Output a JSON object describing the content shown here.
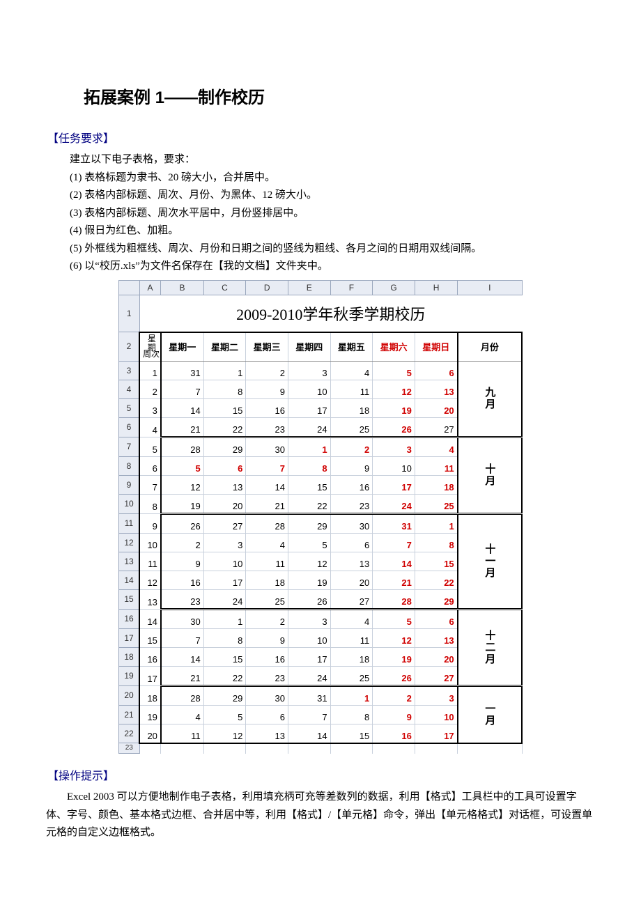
{
  "heading": "拓展案例 1——制作校历",
  "req_header": "【任务要求】",
  "req_intro": "建立以下电子表格，要求：",
  "reqs": [
    "(1) 表格标题为隶书、20 磅大小，合并居中。",
    "(2) 表格内部标题、周次、月份、为黑体、12 磅大小。",
    "(3) 表格内部标题、周次水平居中，月份竖排居中。",
    "(4) 假日为红色、加粗。",
    "(5) 外框线为粗框线、周次、月份和日期之间的竖线为粗线、各月之间的日期用双线间隔。",
    "(6) 以“校历.xls”为文件名保存在【我的文档】文件夹中。"
  ],
  "hint_header": "【操作提示】",
  "hint_text": "Excel 2003 可以方便地制作电子表格，利用填充柄可充等差数列的数据，利用【格式】工具栏中的工具可设置字体、字号、颜色、基本格式边框、合并居中等，利用【格式】/【单元格】命令，弹出【单元格格式】对话框，可设置单元格的自定义边框格式。",
  "chart_data": {
    "type": "table",
    "title": "2009-2010学年秋季学期校历",
    "col_letters": [
      "A",
      "B",
      "C",
      "D",
      "E",
      "F",
      "G",
      "H",
      "I"
    ],
    "corner": {
      "top_right": "星期",
      "bottom_left": "周次"
    },
    "headers": [
      "星期一",
      "星期二",
      "星期三",
      "星期四",
      "星期五",
      "星期六",
      "星期日",
      "月份"
    ],
    "month_groups": [
      {
        "label": "九月",
        "rows": [
          3,
          4,
          5,
          6
        ]
      },
      {
        "label": "十月",
        "rows": [
          7,
          8,
          9,
          10
        ]
      },
      {
        "label": "十一月",
        "rows": [
          11,
          12,
          13,
          14,
          15
        ]
      },
      {
        "label": "十二月",
        "rows": [
          16,
          17,
          18,
          19
        ]
      },
      {
        "label": "一月",
        "rows": [
          20,
          21,
          22
        ]
      }
    ],
    "rows": [
      {
        "r": 3,
        "week": 1,
        "d": [
          {
            "v": 31
          },
          {
            "v": 1
          },
          {
            "v": 2
          },
          {
            "v": 3
          },
          {
            "v": 4
          },
          {
            "v": 5,
            "h": true
          },
          {
            "v": 6,
            "h": true
          }
        ]
      },
      {
        "r": 4,
        "week": 2,
        "d": [
          {
            "v": 7
          },
          {
            "v": 8
          },
          {
            "v": 9
          },
          {
            "v": 10
          },
          {
            "v": 11
          },
          {
            "v": 12,
            "h": true
          },
          {
            "v": 13,
            "h": true
          }
        ]
      },
      {
        "r": 5,
        "week": 3,
        "d": [
          {
            "v": 14
          },
          {
            "v": 15
          },
          {
            "v": 16
          },
          {
            "v": 17
          },
          {
            "v": 18
          },
          {
            "v": 19,
            "h": true
          },
          {
            "v": 20,
            "h": true
          }
        ]
      },
      {
        "r": 6,
        "week": 4,
        "d": [
          {
            "v": 21
          },
          {
            "v": 22
          },
          {
            "v": 23
          },
          {
            "v": 24
          },
          {
            "v": 25
          },
          {
            "v": 26,
            "h": true
          },
          {
            "v": 27
          }
        ]
      },
      {
        "r": 7,
        "week": 5,
        "d": [
          {
            "v": 28
          },
          {
            "v": 29
          },
          {
            "v": 30
          },
          {
            "v": 1,
            "h": true
          },
          {
            "v": 2,
            "h": true
          },
          {
            "v": 3,
            "h": true
          },
          {
            "v": 4,
            "h": true
          }
        ]
      },
      {
        "r": 8,
        "week": 6,
        "d": [
          {
            "v": 5,
            "h": true
          },
          {
            "v": 6,
            "h": true
          },
          {
            "v": 7,
            "h": true
          },
          {
            "v": 8,
            "h": true
          },
          {
            "v": 9
          },
          {
            "v": 10
          },
          {
            "v": 11,
            "h": true
          }
        ]
      },
      {
        "r": 9,
        "week": 7,
        "d": [
          {
            "v": 12
          },
          {
            "v": 13
          },
          {
            "v": 14
          },
          {
            "v": 15
          },
          {
            "v": 16
          },
          {
            "v": 17,
            "h": true
          },
          {
            "v": 18,
            "h": true
          }
        ]
      },
      {
        "r": 10,
        "week": 8,
        "d": [
          {
            "v": 19
          },
          {
            "v": 20
          },
          {
            "v": 21
          },
          {
            "v": 22
          },
          {
            "v": 23
          },
          {
            "v": 24,
            "h": true
          },
          {
            "v": 25,
            "h": true
          }
        ]
      },
      {
        "r": 11,
        "week": 9,
        "d": [
          {
            "v": 26
          },
          {
            "v": 27
          },
          {
            "v": 28
          },
          {
            "v": 29
          },
          {
            "v": 30
          },
          {
            "v": 31,
            "h": true
          },
          {
            "v": 1,
            "h": true
          }
        ]
      },
      {
        "r": 12,
        "week": 10,
        "d": [
          {
            "v": 2
          },
          {
            "v": 3
          },
          {
            "v": 4
          },
          {
            "v": 5
          },
          {
            "v": 6
          },
          {
            "v": 7,
            "h": true
          },
          {
            "v": 8,
            "h": true
          }
        ]
      },
      {
        "r": 13,
        "week": 11,
        "d": [
          {
            "v": 9
          },
          {
            "v": 10
          },
          {
            "v": 11
          },
          {
            "v": 12
          },
          {
            "v": 13
          },
          {
            "v": 14,
            "h": true
          },
          {
            "v": 15,
            "h": true
          }
        ]
      },
      {
        "r": 14,
        "week": 12,
        "d": [
          {
            "v": 16
          },
          {
            "v": 17
          },
          {
            "v": 18
          },
          {
            "v": 19
          },
          {
            "v": 20
          },
          {
            "v": 21,
            "h": true
          },
          {
            "v": 22,
            "h": true
          }
        ]
      },
      {
        "r": 15,
        "week": 13,
        "d": [
          {
            "v": 23
          },
          {
            "v": 24
          },
          {
            "v": 25
          },
          {
            "v": 26
          },
          {
            "v": 27
          },
          {
            "v": 28,
            "h": true
          },
          {
            "v": 29,
            "h": true
          }
        ]
      },
      {
        "r": 16,
        "week": 14,
        "d": [
          {
            "v": 30
          },
          {
            "v": 1
          },
          {
            "v": 2
          },
          {
            "v": 3
          },
          {
            "v": 4
          },
          {
            "v": 5,
            "h": true
          },
          {
            "v": 6,
            "h": true
          }
        ]
      },
      {
        "r": 17,
        "week": 15,
        "d": [
          {
            "v": 7
          },
          {
            "v": 8
          },
          {
            "v": 9
          },
          {
            "v": 10
          },
          {
            "v": 11
          },
          {
            "v": 12,
            "h": true
          },
          {
            "v": 13,
            "h": true
          }
        ]
      },
      {
        "r": 18,
        "week": 16,
        "d": [
          {
            "v": 14
          },
          {
            "v": 15
          },
          {
            "v": 16
          },
          {
            "v": 17
          },
          {
            "v": 18
          },
          {
            "v": 19,
            "h": true
          },
          {
            "v": 20,
            "h": true
          }
        ]
      },
      {
        "r": 19,
        "week": 17,
        "d": [
          {
            "v": 21
          },
          {
            "v": 22
          },
          {
            "v": 23
          },
          {
            "v": 24
          },
          {
            "v": 25
          },
          {
            "v": 26,
            "h": true
          },
          {
            "v": 27,
            "h": true
          }
        ]
      },
      {
        "r": 20,
        "week": 18,
        "d": [
          {
            "v": 28
          },
          {
            "v": 29
          },
          {
            "v": 30
          },
          {
            "v": 31
          },
          {
            "v": 1,
            "h": true
          },
          {
            "v": 2,
            "h": true
          },
          {
            "v": 3,
            "h": true
          }
        ]
      },
      {
        "r": 21,
        "week": 19,
        "d": [
          {
            "v": 4
          },
          {
            "v": 5
          },
          {
            "v": 6
          },
          {
            "v": 7
          },
          {
            "v": 8
          },
          {
            "v": 9,
            "h": true
          },
          {
            "v": 10,
            "h": true
          }
        ]
      },
      {
        "r": 22,
        "week": 20,
        "d": [
          {
            "v": 11
          },
          {
            "v": 12
          },
          {
            "v": 13
          },
          {
            "v": 14
          },
          {
            "v": 15
          },
          {
            "v": 16,
            "h": true
          },
          {
            "v": 17,
            "h": true
          }
        ]
      }
    ],
    "extra_row_number": 23
  }
}
